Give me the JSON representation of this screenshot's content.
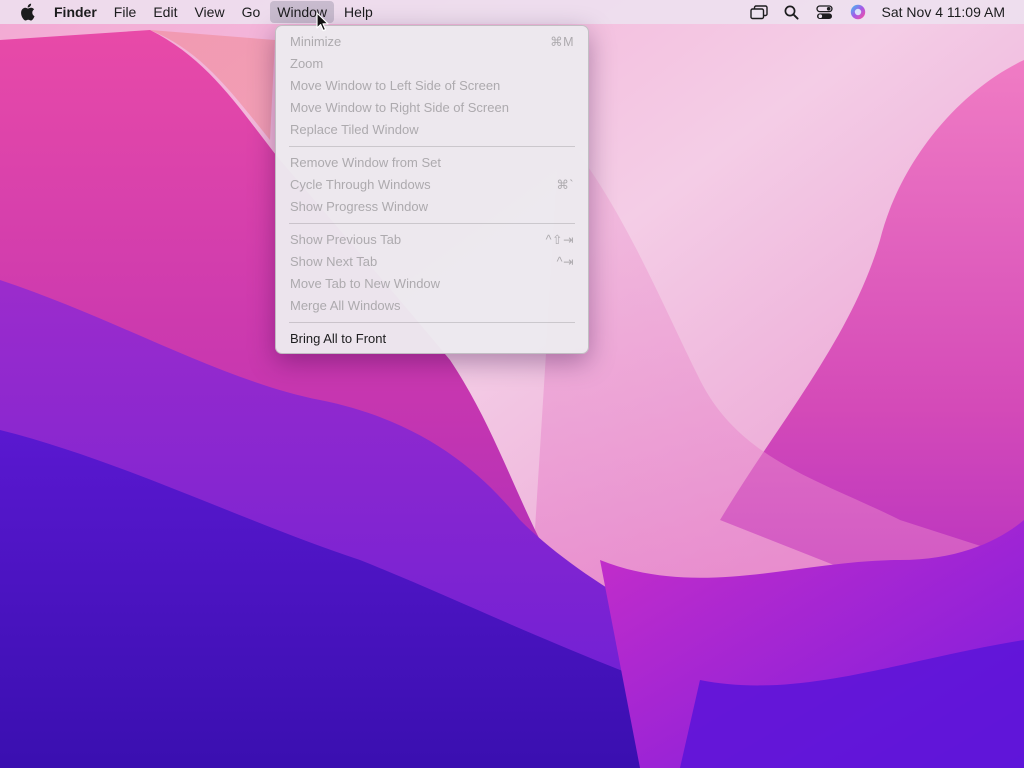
{
  "menubar": {
    "apple_icon": "apple-logo-icon",
    "app_name": "Finder",
    "menus": [
      "File",
      "Edit",
      "View",
      "Go",
      "Window",
      "Help"
    ],
    "active_menu": "Window",
    "status_icons": [
      "screen-mirroring-icon",
      "spotlight-search-icon",
      "control-center-icon",
      "siri-icon"
    ],
    "clock": "Sat Nov 4  11:09 AM"
  },
  "window_menu": {
    "groups": [
      [
        {
          "label": "Minimize",
          "shortcut": "⌘M",
          "enabled": false
        },
        {
          "label": "Zoom",
          "shortcut": "",
          "enabled": false
        },
        {
          "label": "Move Window to Left Side of Screen",
          "shortcut": "",
          "enabled": false
        },
        {
          "label": "Move Window to Right Side of Screen",
          "shortcut": "",
          "enabled": false
        },
        {
          "label": "Replace Tiled Window",
          "shortcut": "",
          "enabled": false
        }
      ],
      [
        {
          "label": "Remove Window from Set",
          "shortcut": "",
          "enabled": false
        },
        {
          "label": "Cycle Through Windows",
          "shortcut": "⌘`",
          "enabled": false
        },
        {
          "label": "Show Progress Window",
          "shortcut": "",
          "enabled": false
        }
      ],
      [
        {
          "label": "Show Previous Tab",
          "shortcut": "^⇧⇥",
          "enabled": false
        },
        {
          "label": "Show Next Tab",
          "shortcut": "^⇥",
          "enabled": false
        },
        {
          "label": "Move Tab to New Window",
          "shortcut": "",
          "enabled": false
        },
        {
          "label": "Merge All Windows",
          "shortcut": "",
          "enabled": false
        }
      ],
      [
        {
          "label": "Bring All to Front",
          "shortcut": "",
          "enabled": true
        }
      ]
    ]
  },
  "colors": {
    "wallpaper_top_pink": "#e25cb4",
    "wallpaper_light": "#f0c8e6",
    "wallpaper_purple": "#6a22d6",
    "wallpaper_deep": "#3d10b8",
    "disabled_text": "#adaaae",
    "enabled_text": "#1d1d1f"
  }
}
